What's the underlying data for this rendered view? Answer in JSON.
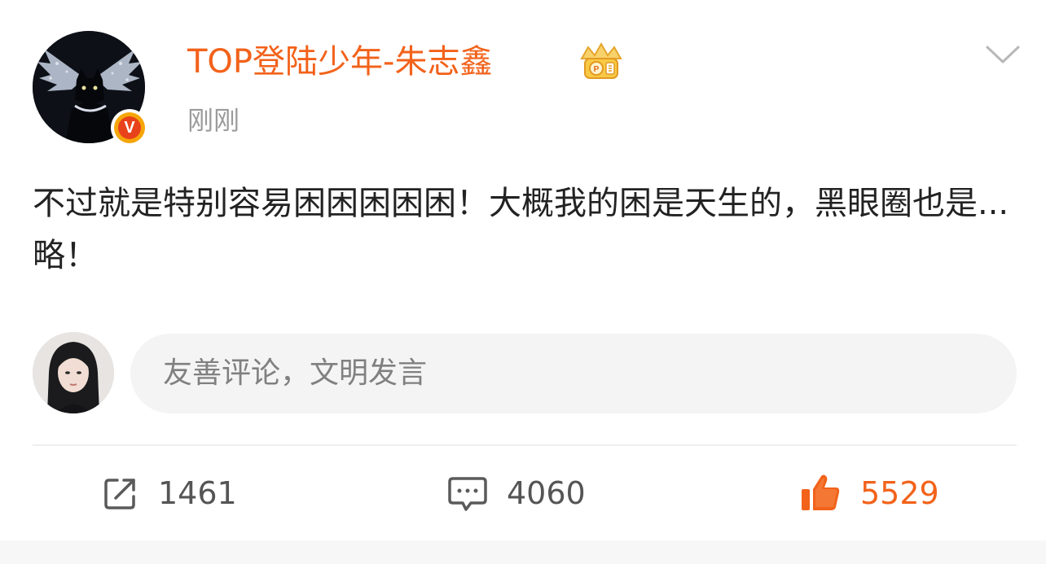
{
  "header": {
    "username": "TOP登陆少年-朱志鑫",
    "timestamp": "刚刚",
    "crown_icon": "crown-badge-icon",
    "verified_icon": "verified-v-icon",
    "more_icon": "chevron-down-icon"
  },
  "post": {
    "text": "不过就是特别容易困困困困困！大概我的困是天生的，黑眼圈也是...略！"
  },
  "comment": {
    "placeholder": "友善评论，文明发言"
  },
  "actions": {
    "repost": {
      "icon": "share-icon",
      "count": "1461"
    },
    "comment": {
      "icon": "comment-icon",
      "count": "4060"
    },
    "like": {
      "icon": "thumbs-up-icon",
      "count": "5529"
    }
  },
  "colors": {
    "accent": "#f2621a",
    "muted": "#9b9b9b",
    "text": "#222222",
    "input_bg": "#f4f4f4"
  }
}
